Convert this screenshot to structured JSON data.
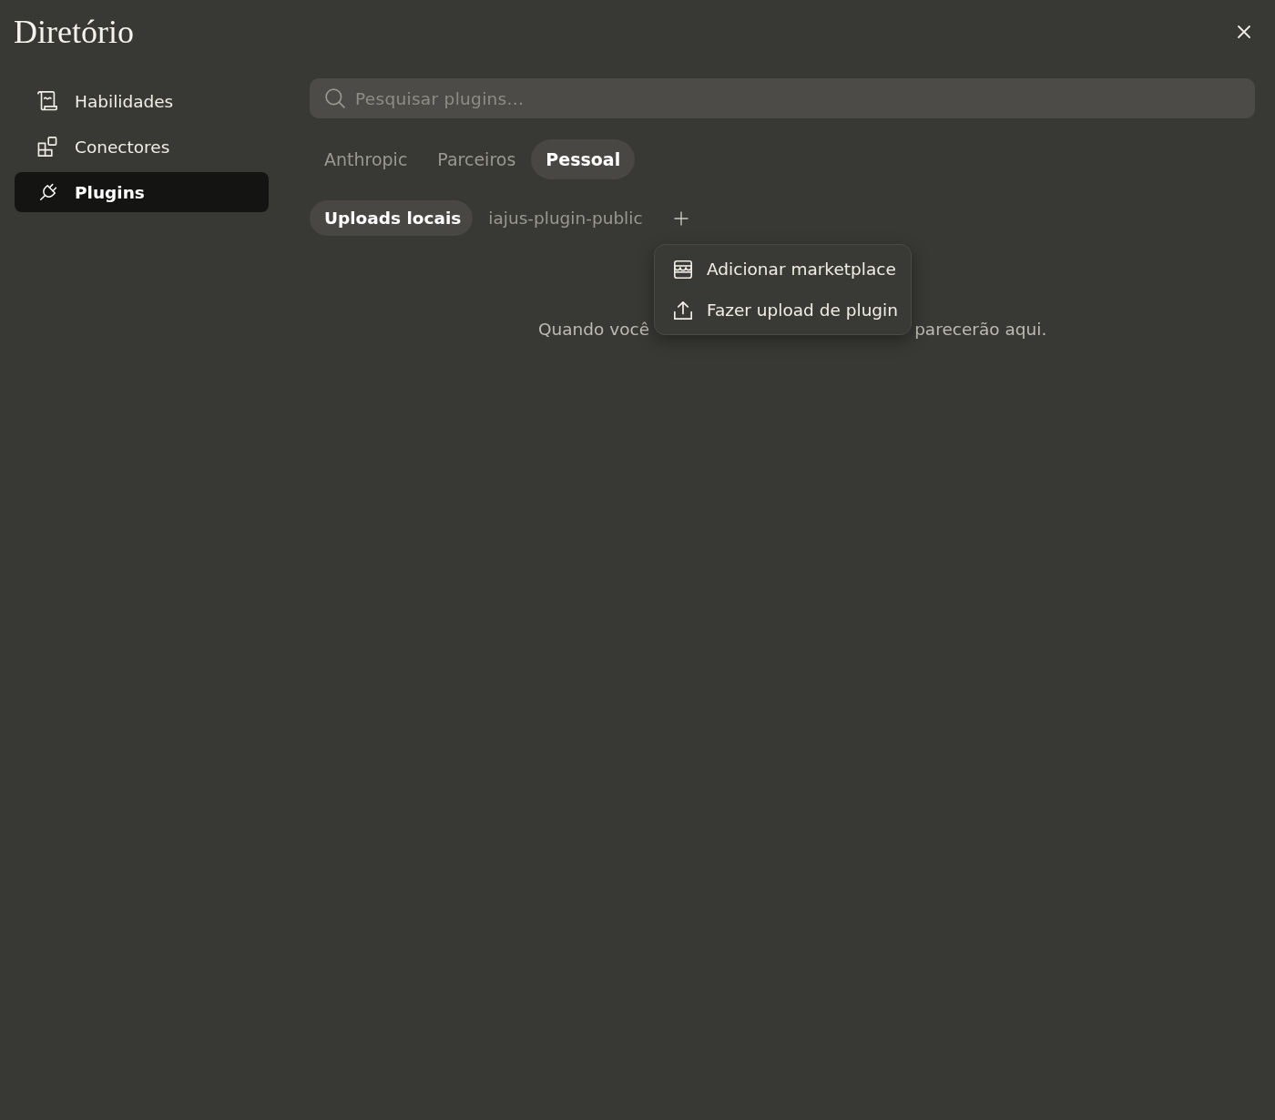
{
  "window": {
    "title": "Diretório"
  },
  "sidebar": {
    "items": [
      {
        "kind": "skills",
        "label": "Habilidades",
        "selected": false
      },
      {
        "kind": "connectors",
        "label": "Conectores",
        "selected": false
      },
      {
        "kind": "plugins",
        "label": "Plugins",
        "selected": true
      }
    ]
  },
  "search": {
    "placeholder": "Pesquisar plugins..."
  },
  "tabs": [
    {
      "label": "Anthropic",
      "selected": false
    },
    {
      "label": "Parceiros",
      "selected": false
    },
    {
      "label": "Pessoal",
      "selected": true
    }
  ],
  "sources": [
    {
      "label": "Uploads locais",
      "selected": true
    },
    {
      "label": "iajus-plugin-public",
      "selected": false
    }
  ],
  "add_menu": {
    "open": true,
    "items": [
      {
        "kind": "marketplace",
        "label": "Adicionar marketplace"
      },
      {
        "kind": "upload",
        "label": "Fazer upload de plugin"
      }
    ]
  },
  "empty_state": {
    "parts": [
      "Quando você",
      "parecerão aqui."
    ]
  }
}
